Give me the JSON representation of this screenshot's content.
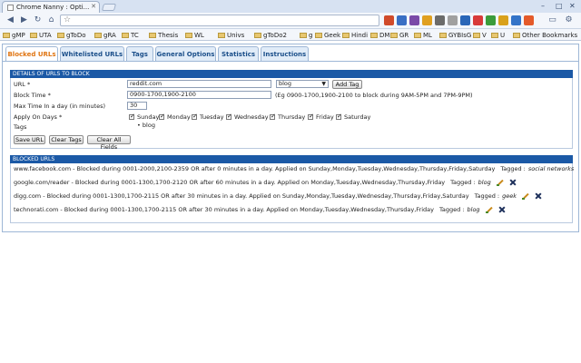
{
  "browser": {
    "tab_title": "Chrome Nanny : Opti...",
    "window_controls": [
      "–",
      "□",
      "✕"
    ],
    "bookmarks": [
      "gMP",
      "UTA",
      "gToDo",
      "gRA",
      "TC",
      "Thesis",
      "WL",
      "Univs",
      "gToDo2",
      "g",
      "Geek",
      "Hindi",
      "DM",
      "GR",
      "ML",
      "GYBIsG",
      "V",
      "U"
    ],
    "other_bookmarks": "Other Bookmarks"
  },
  "tabs": [
    "Blocked URLs",
    "Whitelisted URLs",
    "Tags",
    "General Options",
    "Statistics",
    "Instructions"
  ],
  "form": {
    "section_title": "DETAILS OF URLS TO BLOCK",
    "url_label": "URL *",
    "url_value": "reddit.com",
    "tag_select_value": "blog",
    "add_tag_label": "Add Tag",
    "block_time_label": "Block Time *",
    "block_time_value": "0900-1700,1900-2100",
    "block_time_hint": "(Eg 0900-1700,1900-2100 to block during 9AM-5PM and 7PM-9PM)",
    "max_time_label": "Max Time In a day (in minutes)",
    "max_time_value": "30",
    "apply_days_label": "Apply On Days *",
    "days": [
      "Sunday",
      "Monday",
      "Tuesday",
      "Wednesday",
      "Thursday",
      "Friday",
      "Saturday"
    ],
    "tags_label": "Tags",
    "tags": [
      "blog"
    ],
    "save_label": "Save URL",
    "clear_tags_label": "Clear Tags",
    "clear_all_label": "Clear All Fields"
  },
  "blocked": {
    "section_title": "BLOCKED URLS",
    "entries": [
      {
        "text": "www.facebook.com - Blocked during 0001-2000,2100-2359 OR after 0 minutes in a day. Applied on Sunday,Monday,Tuesday,Wednesday,Thursday,Friday,Saturday",
        "tagged": "Tagged :",
        "tag": "social networks",
        "actions": false
      },
      {
        "text": "google.com/reader - Blocked during 0001-1300,1700-2120 OR after 60 minutes in a day. Applied on Monday,Tuesday,Wednesday,Thursday,Friday",
        "tagged": "Tagged :",
        "tag": "blog",
        "actions": true
      },
      {
        "text": "digg.com - Blocked during 0001-1300,1700-2115 OR after 30 minutes in a day. Applied on Sunday,Monday,Tuesday,Wednesday,Thursday,Friday,Saturday",
        "tagged": "Tagged :",
        "tag": "geek",
        "actions": true
      },
      {
        "text": "technorati.com - Blocked during 0001-1300,1700-2115 OR after 30 minutes in a day. Applied on Monday,Tuesday,Wednesday,Thursday,Friday",
        "tagged": "Tagged :",
        "tag": "blog",
        "actions": true
      }
    ]
  }
}
